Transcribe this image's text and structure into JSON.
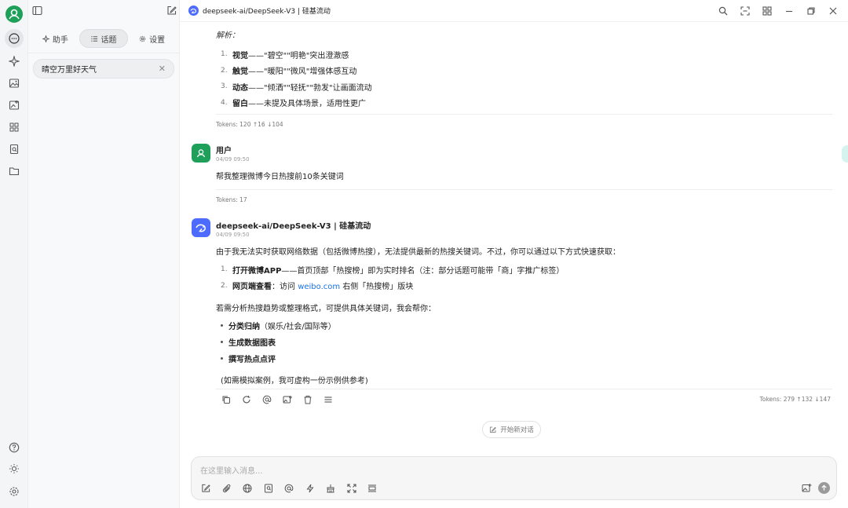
{
  "header": {
    "model_title": "deepseek-ai/DeepSeek-V3 | 硅基流动"
  },
  "panel": {
    "tabs": [
      {
        "label": "助手",
        "icon": "sparkle-icon"
      },
      {
        "label": "话题",
        "icon": "list-icon"
      },
      {
        "label": "设置",
        "icon": "gear-icon"
      }
    ],
    "active_tab": "话题",
    "topics": [
      {
        "label": "晴空万里好天气"
      }
    ]
  },
  "messages": {
    "prev": {
      "analysis_label": "解析：",
      "items": [
        {
          "num": "1.",
          "bold": "视觉",
          "text": "——\"碧空\"\"明艳\"突出澄澈感"
        },
        {
          "num": "2.",
          "bold": "触觉",
          "text": "——\"暖阳\"\"微风\"增强体感互动"
        },
        {
          "num": "3.",
          "bold": "动态",
          "text": "——\"倾洒\"\"轻抚\"\"勃发\"让画面流动"
        },
        {
          "num": "4.",
          "bold": "留白",
          "text": "——未提及具体场景，适用性更广"
        }
      ],
      "tokens": "Tokens: 120 ↑16 ↓104"
    },
    "user": {
      "name": "用户",
      "time": "04/09 09:50",
      "text": "帮我整理微博今日热搜前10条关键词",
      "tokens": "Tokens: 17"
    },
    "assistant": {
      "name": "deepseek-ai/DeepSeek-V3 | 硅基流动",
      "time": "04/09 09:50",
      "intro": "由于我无法实时获取网络数据（包括微博热搜），无法提供最新的热搜关键词。不过，你可以通过以下方式快速获取：",
      "items": [
        {
          "num": "1.",
          "bold": "打开微博APP",
          "text": "——首页顶部「热搜榜」即为实时排名（注：部分话题可能带「商」字推广标签）"
        },
        {
          "num": "2.",
          "bold": "网页端查看",
          "text_before": "：访问 ",
          "link": "weibo.com",
          "text_after": " 右侧「热搜榜」版块"
        }
      ],
      "mid": "若需分析热搜趋势或整理格式，可提供具体关键词，我会帮你：",
      "bullets": [
        {
          "bold": "分类归纳",
          "text": "（娱乐/社会/国际等）"
        },
        {
          "bold": "生成数据图表",
          "text": ""
        },
        {
          "bold": "撰写热点点评",
          "text": ""
        }
      ],
      "note": "(如需模拟案例，我可虚构一份示例供参考)",
      "tokens": "Tokens: 279 ↑132 ↓147"
    }
  },
  "new_chat": {
    "label": "开始新对话"
  },
  "composer": {
    "placeholder": "在这里输入消息..."
  },
  "colors": {
    "accent_green": "#1fa05a",
    "deepseek_blue": "#4d6bfe",
    "link_blue": "#1a73e8"
  }
}
